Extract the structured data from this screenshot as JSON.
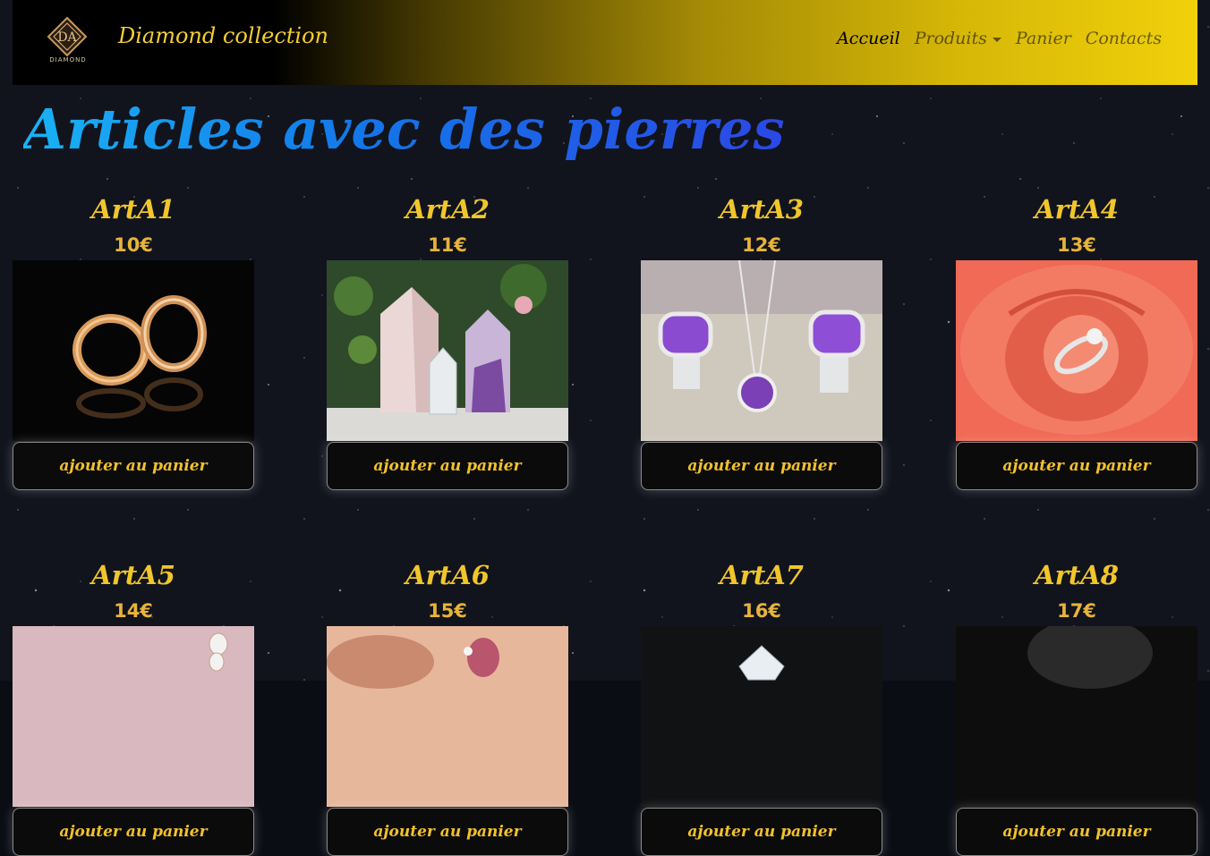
{
  "navbar": {
    "brand": "Diamond collection",
    "logo_text": "DIAMOND",
    "links": [
      "Accueil",
      "Produits",
      "Panier",
      "Contacts"
    ]
  },
  "page": {
    "title": "Articles avec des pierres"
  },
  "cart_button_label": "ajouter au panier",
  "products": [
    {
      "name": "ArtA1",
      "price": "10€",
      "image": "gold-hoop-earrings-photo"
    },
    {
      "name": "ArtA2",
      "price": "11€",
      "image": "quartz-crystals-photo"
    },
    {
      "name": "ArtA3",
      "price": "12€",
      "image": "amethyst-jewelry-set-photo"
    },
    {
      "name": "ArtA4",
      "price": "13€",
      "image": "ring-in-rose-photo"
    },
    {
      "name": "ArtA5",
      "price": "14€",
      "image": "pink-earrings-photo"
    },
    {
      "name": "ArtA6",
      "price": "15€",
      "image": "hand-with-ring-photo"
    },
    {
      "name": "ArtA7",
      "price": "16€",
      "image": "diamond-ring-photo"
    },
    {
      "name": "ArtA8",
      "price": "17€",
      "image": "dark-fabric-photo"
    }
  ],
  "colors": {
    "navbar_gradient_end": "#f0d10a",
    "title_gradient": [
      "#19b3f5",
      "#2b48e6"
    ],
    "product_text": "#f1c62b",
    "button_bg": "#0b0b0b"
  }
}
